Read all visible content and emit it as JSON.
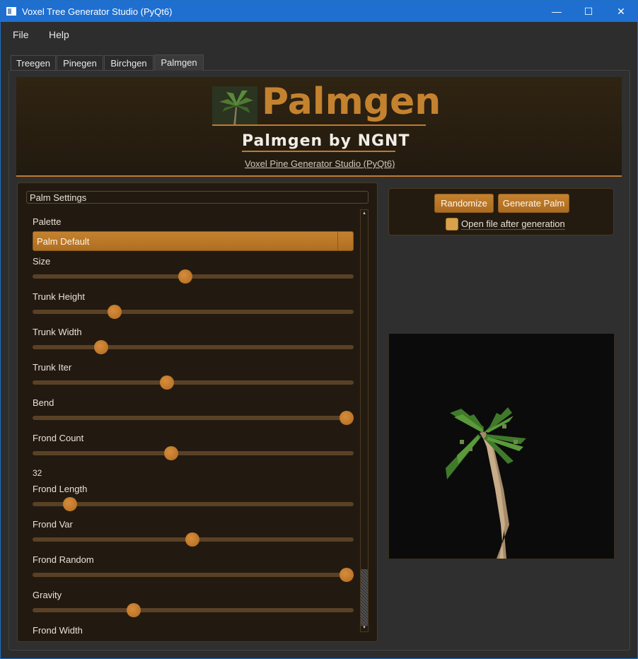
{
  "window": {
    "title": "Voxel Tree Generator Studio (PyQt6)",
    "controls": {
      "minimize": "—",
      "maximize": "☐",
      "close": "✕"
    }
  },
  "menu": {
    "file": "File",
    "help": "Help"
  },
  "tabs": [
    {
      "label": "Treegen"
    },
    {
      "label": "Pinegen"
    },
    {
      "label": "Birchgen"
    },
    {
      "label": "Palmgen"
    }
  ],
  "header": {
    "logo_text": "Palmgen",
    "subtitle": "Palmgen by NGNT",
    "byline": "Voxel Pine Generator Studio (PyQt6)"
  },
  "settings": {
    "group_title": "Palm Settings",
    "palette_label": "Palette",
    "palette_value": "Palm Default",
    "sliders": [
      {
        "label": "Size",
        "value": 0.475
      },
      {
        "label": "Trunk Height",
        "value": 0.245
      },
      {
        "label": "Trunk Width",
        "value": 0.2
      },
      {
        "label": "Trunk Iter",
        "value": 0.415
      },
      {
        "label": "Bend",
        "value": 1.0
      },
      {
        "label": "Frond Count",
        "value": 0.428
      },
      {
        "label": "Frond Length",
        "value": 0.1
      },
      {
        "label": "Frond Var",
        "value": 0.497
      },
      {
        "label": "Frond Random",
        "value": 1.0
      },
      {
        "label": "Gravity",
        "value": 0.306
      }
    ],
    "frond_count_value": "32",
    "partial_label": "Frond Width"
  },
  "actions": {
    "randomize": "Randomize",
    "generate": "Generate Palm",
    "open_after": "Open file after generation",
    "open_after_checked": false
  },
  "colors": {
    "accent": "#c4822f",
    "titlebar": "#1e6fd0",
    "panel_bg": "#221a10"
  }
}
